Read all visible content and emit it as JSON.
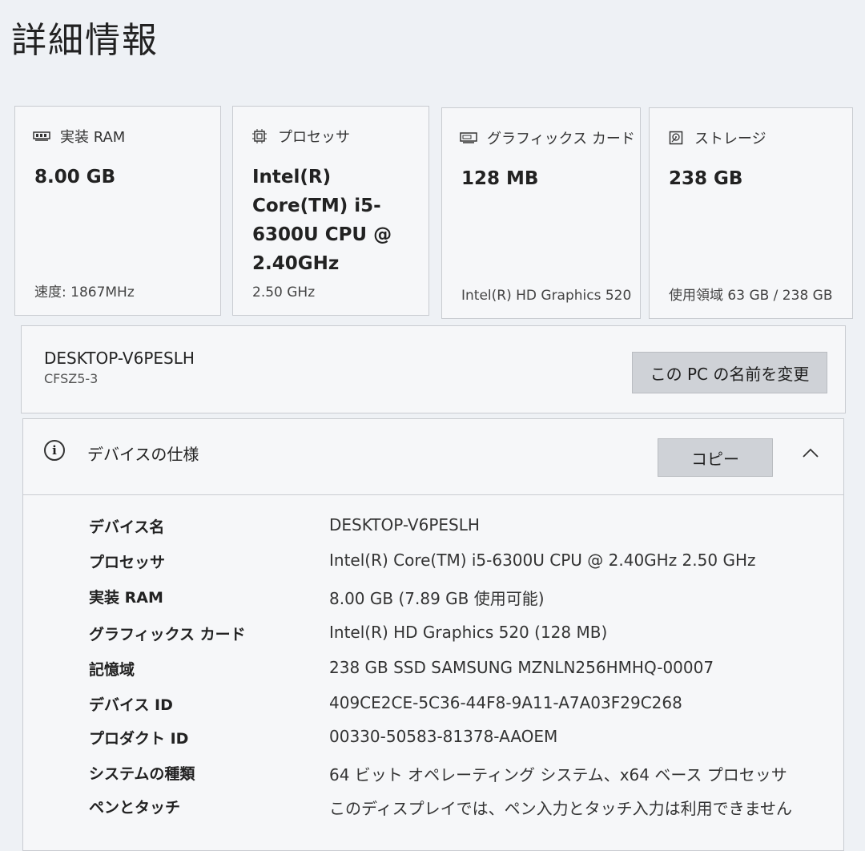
{
  "page": {
    "title": "詳細情報"
  },
  "cards": [
    {
      "label": "実装 RAM",
      "icon": "ram-icon",
      "value": "8.00 GB",
      "footer": "速度: 1867MHz"
    },
    {
      "label": "プロセッサ",
      "icon": "processor-icon",
      "value": "Intel(R) Core(TM) i5-6300U CPU @ 2.40GHz",
      "footer": "2.50 GHz"
    },
    {
      "label": "グラフィックス カード",
      "icon": "graphics-card-icon",
      "value": "128 MB",
      "footer": "Intel(R) HD Graphics 520"
    },
    {
      "label": "ストレージ",
      "icon": "storage-icon",
      "value": "238 GB",
      "footer": "使用領域 63 GB / 238 GB"
    }
  ],
  "pc": {
    "name": "DESKTOP-V6PESLH",
    "model": "CFSZ5-3",
    "rename_label": "この PC の名前を変更"
  },
  "specs": {
    "title": "デバイスの仕様",
    "copy_label": "コピー",
    "rows": [
      {
        "label": "デバイス名",
        "value": "DESKTOP-V6PESLH"
      },
      {
        "label": "プロセッサ",
        "value": "Intel(R) Core(TM) i5-6300U CPU @ 2.40GHz   2.50 GHz"
      },
      {
        "label": "実装 RAM",
        "value": "8.00 GB (7.89 GB 使用可能)"
      },
      {
        "label": "グラフィックス カード",
        "value": "Intel(R) HD Graphics 520 (128 MB)"
      },
      {
        "label": "記憶域",
        "value": "238 GB SSD SAMSUNG MZNLN256HMHQ-00007"
      },
      {
        "label": "デバイス ID",
        "value": "409CE2CE-5C36-44F8-9A11-A7A03F29C268"
      },
      {
        "label": "プロダクト ID",
        "value": "00330-50583-81378-AAOEM"
      },
      {
        "label": "システムの種類",
        "value": "64 ビット オペレーティング システム、x64 ベース プロセッサ"
      },
      {
        "label": "ペンとタッチ",
        "value": "このディスプレイでは、ペン入力とタッチ入力は利用できません"
      }
    ]
  }
}
